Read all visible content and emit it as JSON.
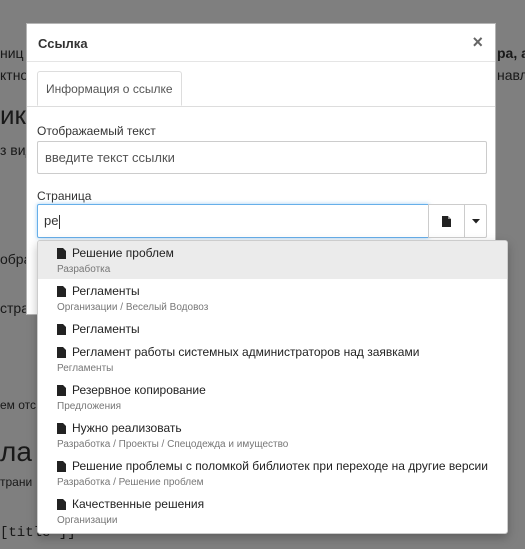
{
  "background": {
    "fragments": [
      {
        "text": "ниц"
      },
      {
        "text": "ктно"
      },
      {
        "text": "ик"
      },
      {
        "text": "з вид"
      },
      {
        "text": "обра"
      },
      {
        "text": "стра"
      },
      {
        "text": "ем отс"
      },
      {
        "text": "ла "
      },
      {
        "text": "трани"
      },
      {
        "text": "[title\"]]"
      },
      {
        "text": "ра, а"
      },
      {
        "text": "навл"
      }
    ]
  },
  "modal": {
    "title": "Ссылка",
    "close_symbol": "×",
    "tab_label": "Информация о ссылке",
    "display_text_label": "Отображаемый текст",
    "display_text_placeholder": "введите текст ссылки",
    "page_label": "Страница",
    "page_value": "ре"
  },
  "dropdown": {
    "items": [
      {
        "title": "Решение проблем",
        "subtitle": "Разработка"
      },
      {
        "title": "Регламенты",
        "subtitle": "Организации / Веселый Водовоз"
      },
      {
        "title": "Регламенты",
        "subtitle": ""
      },
      {
        "title": "Регламент работы системных администраторов над заявками",
        "subtitle": "Регламенты"
      },
      {
        "title": "Резервное копирование",
        "subtitle": "Предложения"
      },
      {
        "title": "Нужно реализовать",
        "subtitle": "Разработка / Проекты / Спецодежда и имущество"
      },
      {
        "title": "Решение проблемы с поломкой библиотек при переходе на другие версии",
        "subtitle": "Разработка / Решение проблем"
      },
      {
        "title": "Качественные решения",
        "subtitle": "Организации"
      }
    ]
  },
  "icons": {
    "item_icon": "document-icon",
    "page_button_icon": "document-icon",
    "toggle_icon": "caret-down-icon"
  },
  "colors": {
    "overlay": "rgba(0,0,0,0.5)",
    "focus_border": "#66afe9",
    "active_item": "#ebebeb"
  }
}
